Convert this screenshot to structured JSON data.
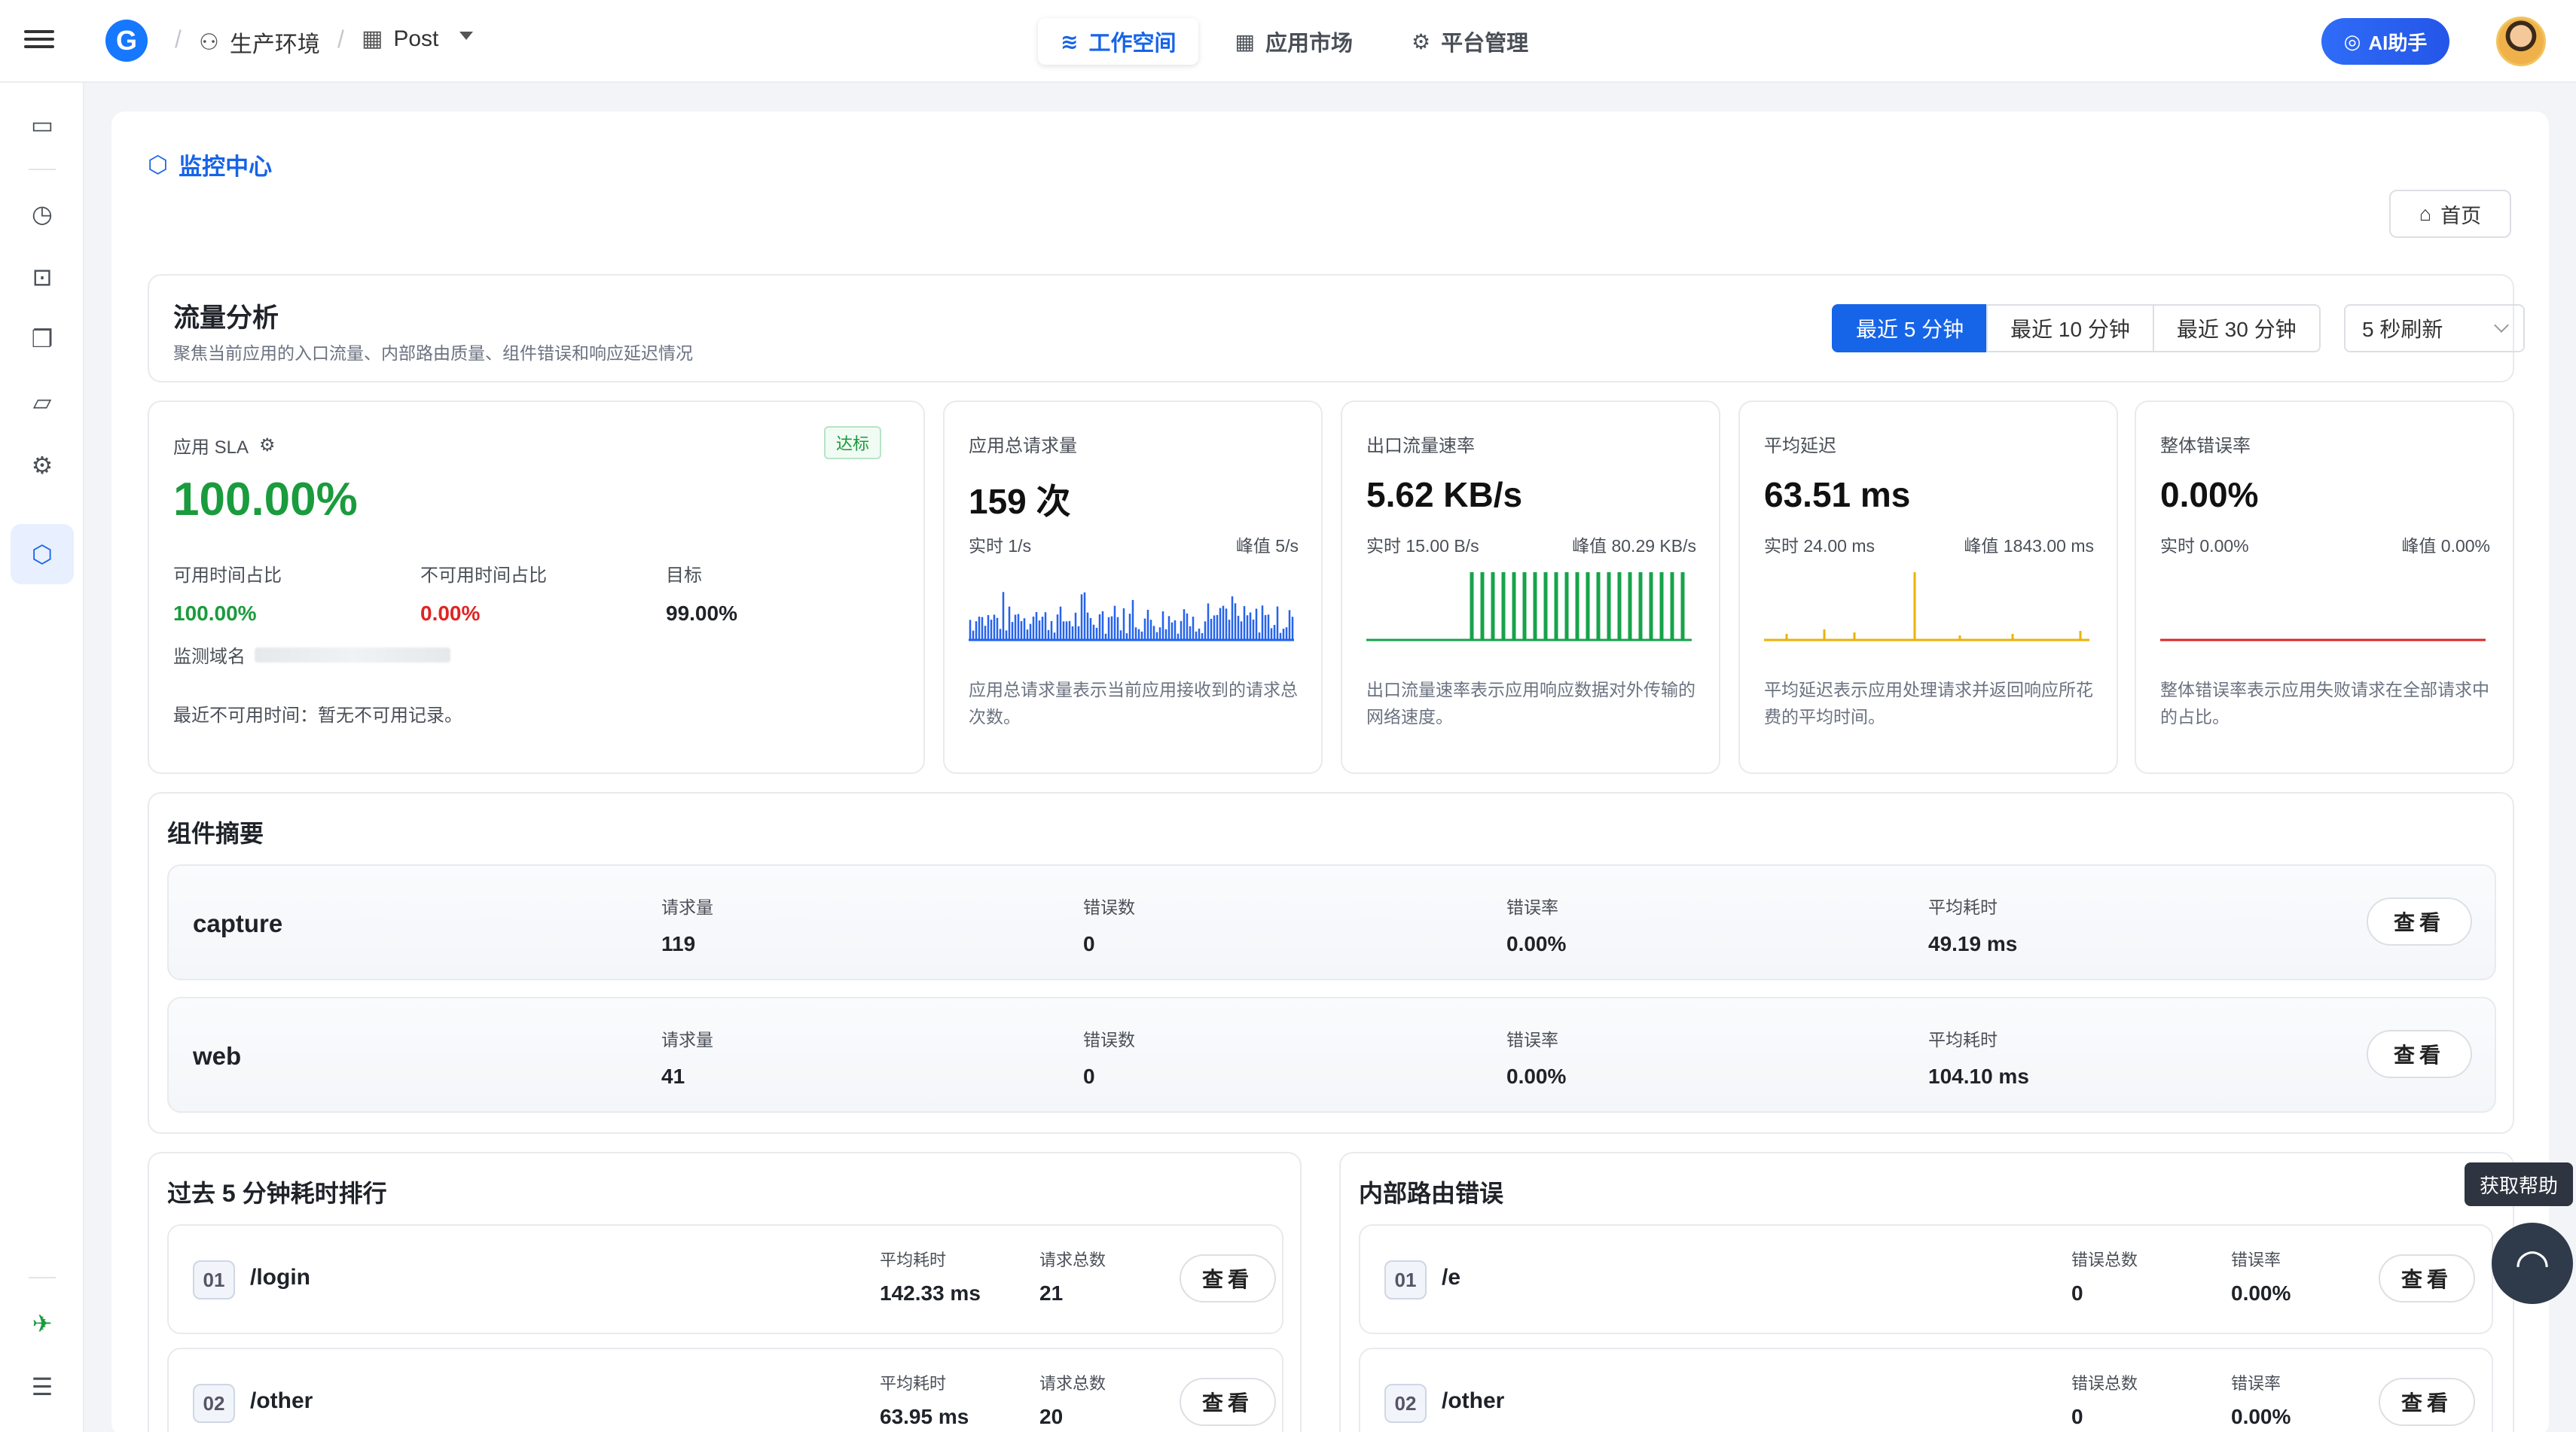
{
  "header": {
    "breadcrumb": [
      {
        "icon": "user-group-icon",
        "label": "生产环境"
      },
      {
        "icon": "grid-icon",
        "label": "Post"
      }
    ],
    "nav": [
      {
        "icon": "layers-icon",
        "label": "工作空间",
        "active": true
      },
      {
        "icon": "grid-icon",
        "label": "应用市场",
        "active": false
      },
      {
        "icon": "gear-icon",
        "label": "平台管理",
        "active": false
      }
    ],
    "ai_label": "AI助手"
  },
  "sidebar": [
    "monitor-icon",
    "clock-icon",
    "robot-icon",
    "docs-icon",
    "folder-icon",
    "gear-icon",
    "box-monitor-icon",
    "rocket-icon",
    "indent-icon"
  ],
  "page": {
    "title": "监控中心",
    "home_label": "首页"
  },
  "traffic": {
    "title": "流量分析",
    "subtitle": "聚焦当前应用的入口流量、内部路由质量、组件错误和响应延迟情况",
    "ranges": [
      "最近 5 分钟",
      "最近 10 分钟",
      "最近 30 分钟"
    ],
    "active_range": "最近 5 分钟",
    "refresh": "5 秒刷新"
  },
  "sla": {
    "label": "应用 SLA",
    "badge": "达标",
    "value": "100.00%",
    "available_label": "可用时间占比",
    "available_value": "100.00%",
    "unavailable_label": "不可用时间占比",
    "unavailable_value": "0.00%",
    "target_label": "目标",
    "target_value": "99.00%",
    "domain_label": "监测域名",
    "recent": "最近不可用时间：暂无不可用记录。"
  },
  "metrics": [
    {
      "label": "应用总请求量",
      "value": "159 次",
      "realtime": "实时  1/s",
      "peak": "峰值  5/s",
      "desc": "应用总请求量表示当前应用接收到的请求总次数。",
      "color": "#2563eb"
    },
    {
      "label": "出口流量速率",
      "value": "5.62 KB/s",
      "realtime": "实时  15.00 B/s",
      "peak": "峰值  80.29 KB/s",
      "desc": "出口流量速率表示应用响应数据对外传输的网络速度。",
      "color": "#16a34a"
    },
    {
      "label": "平均延迟",
      "value": "63.51 ms",
      "realtime": "实时  24.00 ms",
      "peak": "峰值  1843.00 ms",
      "desc": "平均延迟表示应用处理请求并返回响应所花费的平均时间。",
      "color": "#eab308"
    },
    {
      "label": "整体错误率",
      "value": "0.00%",
      "realtime": "实时  0.00%",
      "peak": "峰值  0.00%",
      "desc": "整体错误率表示应用失败请求在全部请求中的占比。",
      "color": "#dc2626"
    }
  ],
  "components": {
    "title": "组件摘要",
    "col_labels": [
      "请求量",
      "错误数",
      "错误率",
      "平均耗时"
    ],
    "view_label": "查看",
    "rows": [
      {
        "name": "capture",
        "values": [
          "119",
          "0",
          "0.00%",
          "49.19 ms"
        ]
      },
      {
        "name": "web",
        "values": [
          "41",
          "0",
          "0.00%",
          "104.10 ms"
        ]
      }
    ]
  },
  "ranking": {
    "title": "过去 5 分钟耗时排行",
    "col_labels": [
      "平均耗时",
      "请求总数"
    ],
    "view_label": "查看",
    "rows": [
      {
        "num": "01",
        "path": "/login",
        "values": [
          "142.33 ms",
          "21"
        ]
      },
      {
        "num": "02",
        "path": "/other",
        "values": [
          "63.95 ms",
          "20"
        ]
      }
    ]
  },
  "route_errors": {
    "title": "内部路由错误",
    "col_labels": [
      "错误总数",
      "错误率"
    ],
    "view_label": "查看",
    "rows": [
      {
        "num": "01",
        "path": "/e",
        "values": [
          "0",
          "0.00%"
        ]
      },
      {
        "num": "02",
        "path": "/other",
        "values": [
          "0",
          "0.00%"
        ]
      }
    ]
  },
  "help": {
    "tooltip": "获取帮助"
  }
}
